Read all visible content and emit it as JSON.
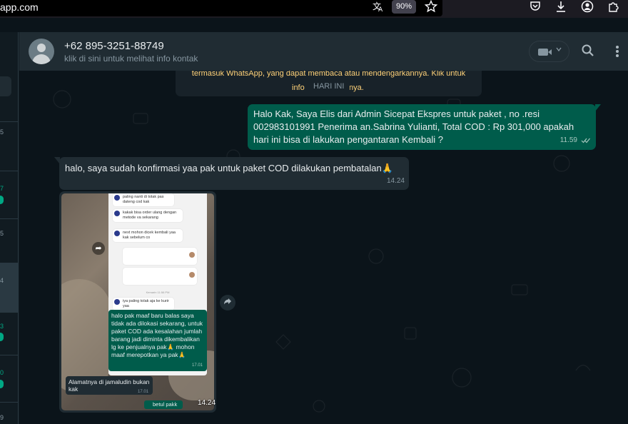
{
  "browser": {
    "url": "app.com",
    "zoom": "90%"
  },
  "left_panel": {
    "numbers": [
      "5",
      "7",
      "5",
      "4",
      "3",
      "0",
      "9"
    ]
  },
  "header": {
    "contact_name": "+62 895-3251-88749",
    "contact_subtitle": "klik di sini untuk melihat info kontak"
  },
  "chat": {
    "notice_line1": "termasuk WhatsApp, yang dapat membaca atau mendengarkannya. Klik untuk",
    "notice_line2_left": "info",
    "notice_line2_right": "nya.",
    "date_chip": "HARI INI",
    "messages": [
      {
        "direction": "out",
        "text": "Halo Kak, Saya Elis dari Admin Sicepat Ekspres untuk paket , no .resi 002983101991 Penerima an.Sabrina Yulianti, Total COD : Rp 301,000 apakah hari ini bisa di lakukan pengantaran Kembali ?",
        "time": "11.59"
      },
      {
        "direction": "in",
        "text": "halo, saya sudah konfirmasi yaa pak untuk paket COD dilakukan pembatalan🙏",
        "time": "14.24"
      }
    ],
    "image_message": {
      "time": "14.24",
      "phone_msgs": [
        "paling nanti di tolak pas dateng cod kak",
        "kakak bisa order ulang dengan metode va sekarang",
        "next mohon dicek kembali yaa kak sebelum co",
        "iya paling tolak aja ke kurir yaa"
      ],
      "phone_small": "Kemarin 11:56 PM",
      "green_card_text": "halo pak maaf baru balas saya tidak ada dilokasi sekarang, untuk paket COD ada kesalahan jumlah barang jadi diminta dikembalikan lg ke penjualnya pak🙏 mohon maaf merepotkan ya pak🙏",
      "green_card_time": "17.01",
      "quote_text": "Alamatnya di jamaludin bukan kak",
      "quote_time": "17.01",
      "reply_text": "betul pakk",
      "reply_time": "17.01"
    }
  }
}
